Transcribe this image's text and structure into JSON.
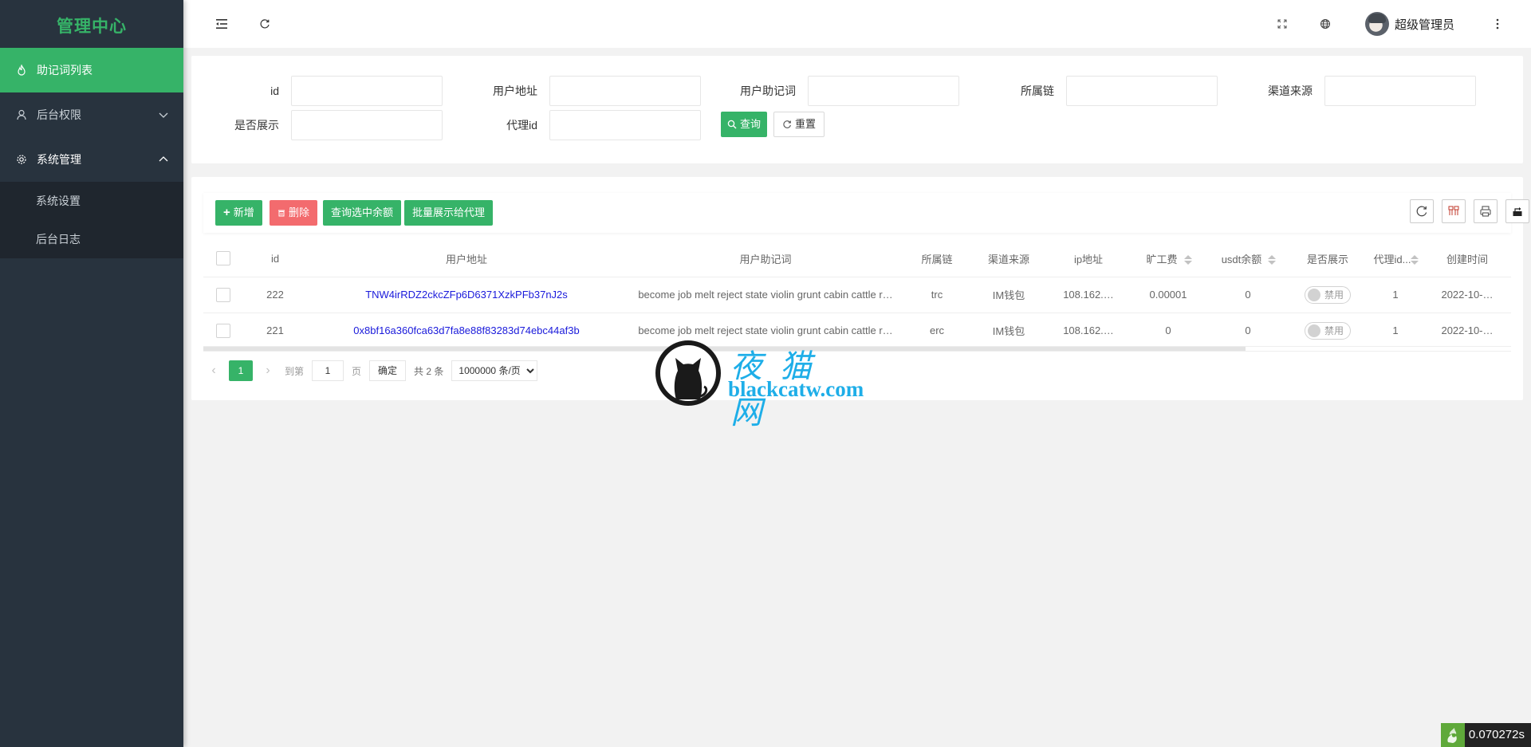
{
  "sidebar": {
    "logo": "管理中心",
    "items": [
      {
        "label": "助记词列表",
        "icon": "fire-icon",
        "active": true
      },
      {
        "label": "后台权限",
        "icon": "user-icon",
        "expanded": false
      },
      {
        "label": "系统管理",
        "icon": "gear-icon",
        "expanded": true,
        "children": [
          {
            "label": "系统设置"
          },
          {
            "label": "后台日志"
          }
        ]
      }
    ]
  },
  "header": {
    "user_name": "超级管理员",
    "icons": [
      "menu-fold-icon",
      "refresh-icon",
      "fullscreen-icon",
      "globe-icon",
      "more-icon"
    ]
  },
  "search": {
    "fields": [
      {
        "label": "id",
        "value": "",
        "placeholder": ""
      },
      {
        "label": "用户地址",
        "value": "",
        "placeholder": ""
      },
      {
        "label": "用户助记词",
        "value": "",
        "placeholder": ""
      },
      {
        "label": "所属链",
        "value": "",
        "placeholder": ""
      },
      {
        "label": "渠道来源",
        "value": "",
        "placeholder": ""
      },
      {
        "label": "是否展示",
        "value": "",
        "placeholder": ""
      },
      {
        "label": "代理id",
        "value": "",
        "placeholder": ""
      }
    ],
    "query_label": "查询",
    "reset_label": "重置"
  },
  "toolbar": {
    "add_label": "新增",
    "delete_label": "删除",
    "query_balance_label": "查询选中余额",
    "batch_show_label": "批量展示给代理",
    "right_icons": [
      "refresh-icon",
      "columns-icon",
      "print-icon",
      "export-icon"
    ]
  },
  "table": {
    "columns": [
      "id",
      "用户地址",
      "用户助记词",
      "所属链",
      "渠道来源",
      "ip地址",
      "旷工费",
      "usdt余额",
      "是否展示",
      "代理id...",
      "创建时间"
    ],
    "rows": [
      {
        "id": "222",
        "address": "TNW4irRDZ2ckcZFp6D6371XzkPFb37nJ2s",
        "mnemonic": "become job melt reject state violin grunt cabin cattle r…",
        "chain": "trc",
        "source": "IM钱包",
        "ip": "108.162.…",
        "fee": "0.00001",
        "usdt": "0",
        "show": "禁用",
        "agent_id": "1",
        "created": "2022-10-…"
      },
      {
        "id": "221",
        "address": "0x8bf16a360fca63d7fa8e88f83283d74ebc44af3b",
        "mnemonic": "become job melt reject state violin grunt cabin cattle r…",
        "chain": "erc",
        "source": "IM钱包",
        "ip": "108.162.…",
        "fee": "0",
        "usdt": "0",
        "show": "禁用",
        "agent_id": "1",
        "created": "2022-10-…"
      }
    ]
  },
  "pagination": {
    "current_page": "1",
    "goto_label": "到第",
    "goto_value": "1",
    "page_unit": "页",
    "confirm_label": "确定",
    "total_label": "共 2 条",
    "page_size_option": "1000000 条/页"
  },
  "watermark": {
    "cn": "夜猫网",
    "en": "blackcatw.com"
  },
  "timing_badge": "0.070272s"
}
